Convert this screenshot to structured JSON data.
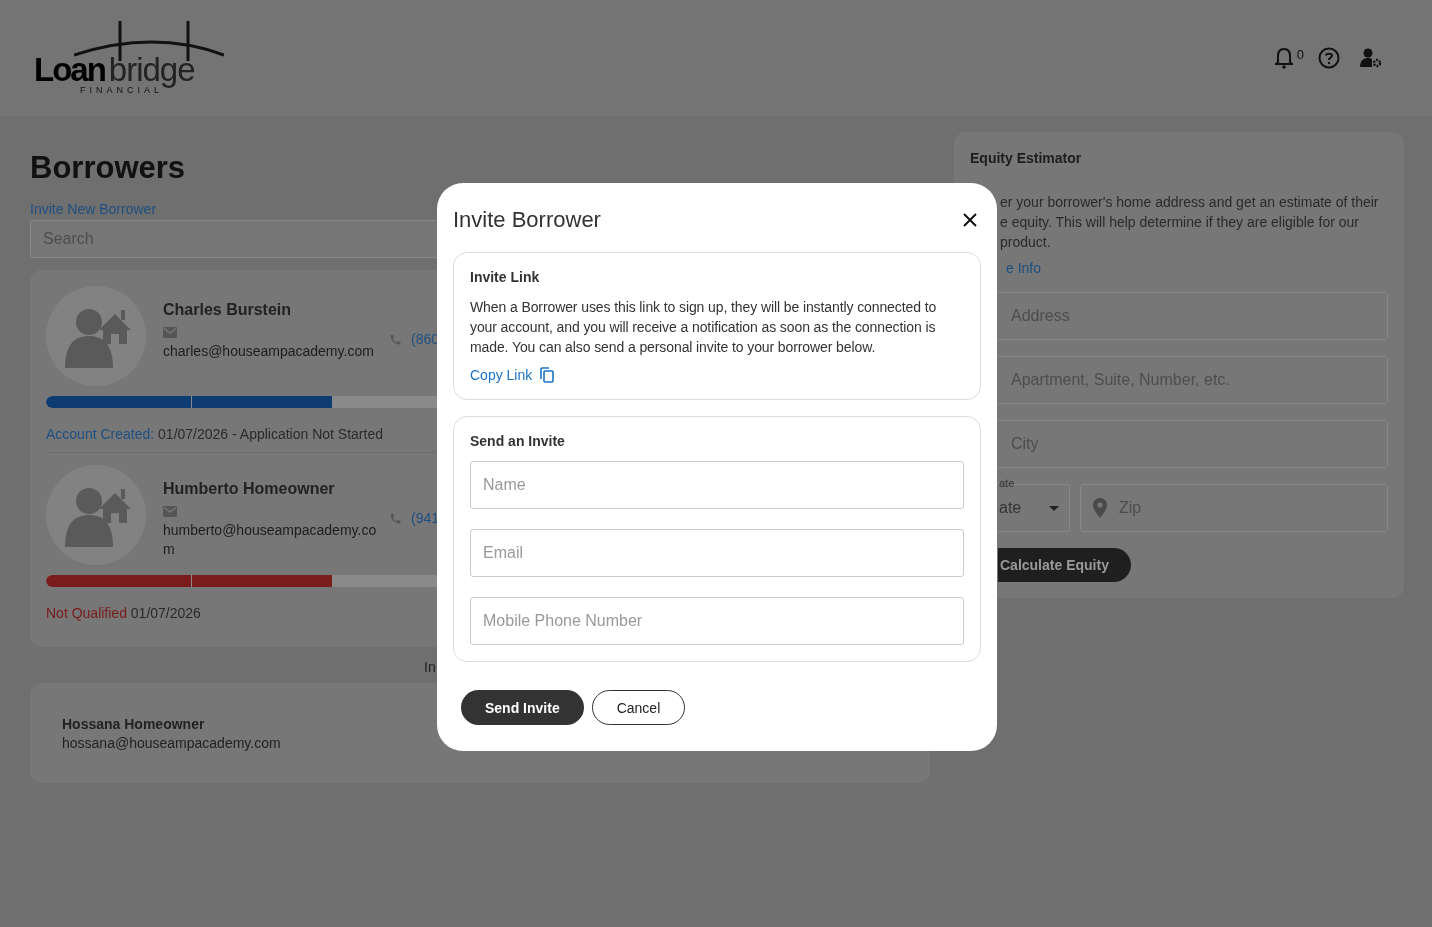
{
  "header": {
    "logo": {
      "word1": "Loan",
      "word2": "bridge",
      "tagline": "FINANCIAL"
    },
    "notification_count": "0"
  },
  "borrowers_page": {
    "title": "Borrowers",
    "invite_link": "Invite New Borrower",
    "search": {
      "placeholder": "Search"
    },
    "borrowers": [
      {
        "name": "Charles Burstein",
        "email": "charles@houseampacademy.com",
        "phone": "(860",
        "kind": "created",
        "level": 0.33,
        "color": "#0d3b72",
        "status_label": "Account Created:",
        "status_text": "01/07/2026 - Application Not Started"
      },
      {
        "name": "Humberto Homeowner",
        "email": "humberto@houseampacademy.com",
        "phone": "(941",
        "kind": "not_qualified",
        "level": 0.33,
        "color": "#7a1c1c",
        "status_label": "Not Qualified",
        "status_text": "01/07/2026"
      }
    ],
    "section_label": "In",
    "pending": [
      {
        "name": "Hossana Homeowner",
        "email": "hossana@houseampacademy.com"
      }
    ]
  },
  "equity_estimator": {
    "title": "Equity Estimator",
    "description_lines": [
      "er your borrower's home address and get an estimate of their",
      "e equity. This will help determine if they are eligible for our",
      "product."
    ],
    "info_link": "e Info",
    "address": {
      "placeholder": "Address"
    },
    "apartment": {
      "placeholder": "Apartment, Suite, Number, etc."
    },
    "city": {
      "placeholder": "City"
    },
    "state": {
      "label": "ate",
      "value": "ate"
    },
    "zip": {
      "placeholder": "Zip"
    },
    "button": "Calculate Equity"
  },
  "modal": {
    "title": "Invite Borrower",
    "invite_link": {
      "title": "Invite Link",
      "text": "When a Borrower uses this link to sign up, they will be instantly connected to your account, and you will receive a notification as soon as the connection is made. You can also send a personal invite to your borrower below.",
      "copy_link": "Copy Link"
    },
    "send_invite": {
      "title": "Send an Invite",
      "fields": [
        {
          "placeholder": "Name"
        },
        {
          "placeholder": "Email"
        },
        {
          "placeholder": "Mobile Phone Number"
        }
      ]
    },
    "buttons": [
      {
        "label": "Send Invite",
        "kind": "primary"
      },
      {
        "label": "Cancel",
        "kind": "secondary"
      }
    ]
  }
}
